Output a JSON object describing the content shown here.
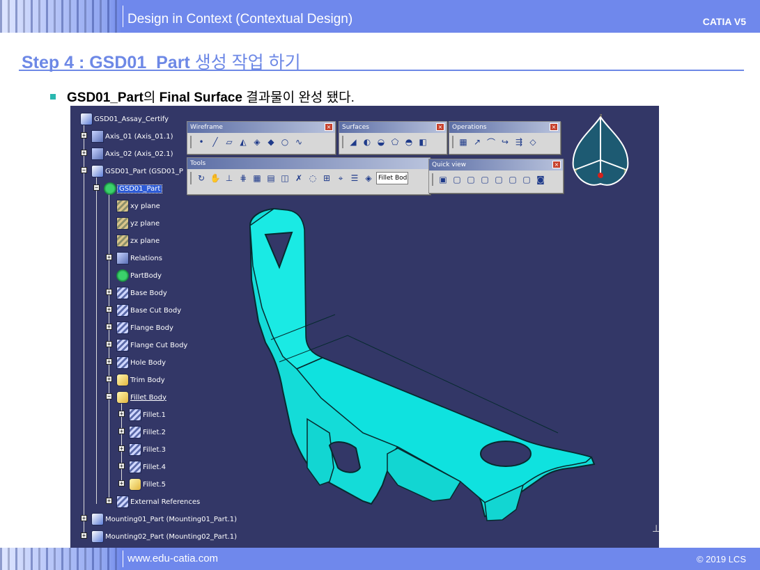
{
  "header": {
    "title": "Design in Context (Contextual Design)",
    "brand": "CATIA V5"
  },
  "step": {
    "prefix": "Step 4 : GSD01_Part",
    "suffix": " 생성 작업 하기"
  },
  "bullet": {
    "part1": "GSD01_Part",
    "part2": "의 ",
    "part3": "Final Surface",
    "part4": " 결과물이 완성 됐다."
  },
  "tree": {
    "root": "GSD01_Assay_Certify",
    "axis1": "Axis_01 (Axis_01.1)",
    "axis2": "Axis_02 (Axis_02.1)",
    "part": "GSD01_Part (GSD01_P",
    "part_node": "GSD01_Part",
    "xy": "xy plane",
    "yz": "yz plane",
    "zx": "zx plane",
    "relations": "Relations",
    "partbody": "PartBody",
    "base_body": "Base Body",
    "base_cut_body": "Base Cut Body",
    "flange_body": "Flange Body",
    "flange_cut_body": "Flange Cut Body",
    "hole_body": "Hole Body",
    "trim_body": "Trim Body",
    "fillet_body": "Fillet Body",
    "fillet1": "Fillet.1",
    "fillet2": "Fillet.2",
    "fillet3": "Fillet.3",
    "fillet4": "Fillet.4",
    "fillet5": "Fillet.5",
    "ext_refs": "External References",
    "mount1": "Mounting01_Part (Mounting01_Part.1)",
    "mount2": "Mounting02_Part (Mounting02_Part.1)"
  },
  "toolbars": {
    "wireframe": "Wireframe",
    "surfaces": "Surfaces",
    "operations": "Operations",
    "tools": "Tools",
    "quick_view": "Quick view",
    "fillet_field": "Fillet Bod"
  },
  "footer": {
    "url": "www.edu-catia.com",
    "copyright": "© 2019 LCS"
  },
  "colors": {
    "accent": "#6d88e6",
    "viewport": "#333767",
    "part": "#14dcd8"
  }
}
